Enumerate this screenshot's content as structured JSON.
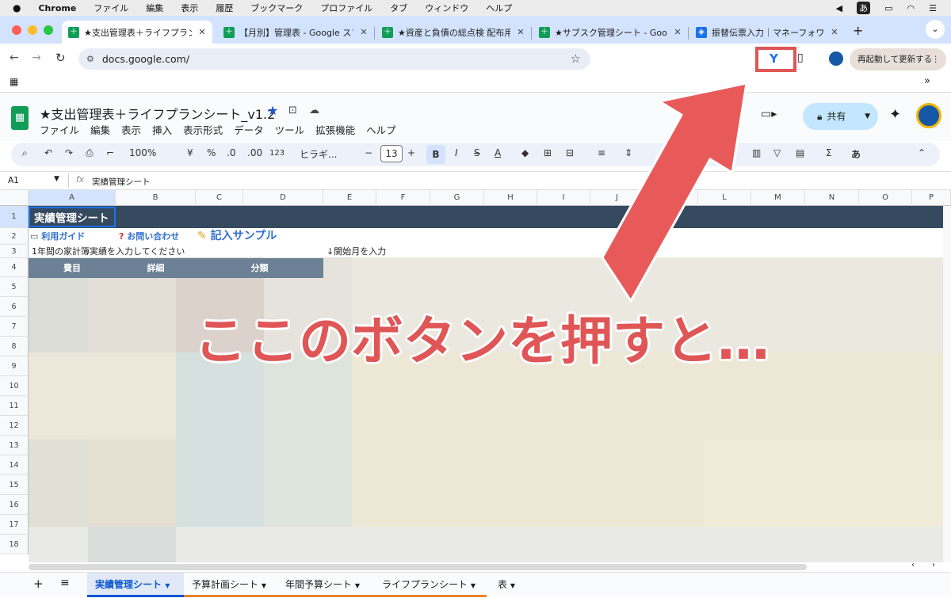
{
  "menubar": {
    "app": "Chrome",
    "items": [
      "ファイル",
      "編集",
      "表示",
      "履歴",
      "ブックマーク",
      "プロファイル",
      "タブ",
      "ウィンドウ",
      "ヘルプ"
    ],
    "ime": "あ"
  },
  "tabs": [
    {
      "title": "★支出管理表＋ライフプランシー",
      "active": true
    },
    {
      "title": "【月別】管理表 - Google スプレ"
    },
    {
      "title": "★資産と負債の総点検 配布用（v"
    },
    {
      "title": "★サブスク管理シート - Google"
    },
    {
      "title": "振替伝票入力｜マネーフォワード"
    }
  ],
  "omnibox": {
    "url": "docs.google.com/"
  },
  "update_button": "再起動して更新する",
  "doc": {
    "title": "★支出管理表＋ライフプランシート_v1.2",
    "share": "共有",
    "menus": [
      "ファイル",
      "編集",
      "表示",
      "挿入",
      "表示形式",
      "データ",
      "ツール",
      "拡張機能",
      "ヘルプ"
    ]
  },
  "toolbar": {
    "zoom": "100%",
    "currency": "¥",
    "percent": "%",
    "dec_minus": ".0",
    "dec_plus": ".00",
    "num": "123",
    "font": "ヒラギ...",
    "size": "13",
    "input_mode": "あ"
  },
  "formula": {
    "ref": "A1",
    "fx": "fx",
    "content": "実績管理シート"
  },
  "columns": [
    "A",
    "B",
    "C",
    "D",
    "E",
    "F",
    "G",
    "H",
    "I",
    "J",
    "K",
    "L",
    "M",
    "N",
    "O",
    "P"
  ],
  "rows": [
    "1",
    "2",
    "3",
    "4",
    "5",
    "6",
    "7",
    "8",
    "9",
    "10",
    "11",
    "12",
    "13",
    "14",
    "15",
    "16",
    "17",
    "18"
  ],
  "cells": {
    "a1": "実績管理シート",
    "a2": "利用ガイド",
    "b2": "お問い合わせ",
    "c2": "記入サンプル",
    "a3": "1年間の家計簿実績を入力してください",
    "e3": "↓開始月を入力",
    "a4": "費目",
    "b4": "詳細",
    "c4": "分類"
  },
  "overlay": {
    "text": "ここのボタンを押すと…",
    "color": "#e05656"
  },
  "sheet_tabs": [
    "実績管理シート",
    "予算計画シート",
    "年間予算シート",
    "ライフプランシート",
    "表"
  ]
}
